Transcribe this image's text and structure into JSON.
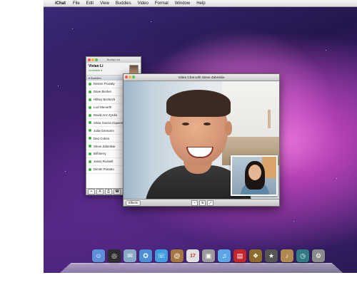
{
  "menubar": {
    "app": "iChat",
    "items": [
      "File",
      "Edit",
      "View",
      "Buddies",
      "Video",
      "Format",
      "Window",
      "Help"
    ]
  },
  "buddy_list": {
    "title": "Buddy List",
    "user_name": "Vivian Li",
    "user_status": "Available ▾",
    "group": "▾ Buddies",
    "buddies": [
      "Darren Prosaty",
      "Dave Becker",
      "Hillary Beckrich",
      "Luci Menerth",
      "David Anz Zyrdio",
      "Silvia Garcia Izquierdo",
      "Julia Gremarm",
      "Dan Cohen",
      "Steve Zabriskie",
      "Bill Berry",
      "Jason Russell",
      "Dimitri Prasato"
    ],
    "bottom_buttons": [
      "+",
      "A",
      "⎙",
      "☎"
    ]
  },
  "video_chat": {
    "title": "Video Chat with Steve Zabriskie",
    "effects_label": "Effects",
    "control_buttons": [
      "+",
      "⇅",
      "⤢"
    ]
  },
  "colors": {
    "close": "#f0574a",
    "minimize": "#f5b33a",
    "zoom": "#5cc443",
    "online": "#39b53f"
  },
  "dock": {
    "icons": [
      {
        "name": "finder-icon",
        "glyph": "☺",
        "color": "#5b90d8"
      },
      {
        "name": "dashboard-icon",
        "glyph": "◎",
        "color": "#2d2d2d"
      },
      {
        "name": "mail-icon",
        "glyph": "✉",
        "color": "#8aa9c8"
      },
      {
        "name": "safari-icon",
        "glyph": "✪",
        "color": "#4a8fd6"
      },
      {
        "name": "ichat-icon",
        "glyph": "☏",
        "color": "#3f9de0"
      },
      {
        "name": "address-book-icon",
        "glyph": "@",
        "color": "#a5773f"
      },
      {
        "name": "ical-icon",
        "glyph": "17",
        "color": "#e0e0e0"
      },
      {
        "name": "preview-icon",
        "glyph": "▣",
        "color": "#9a9a9a"
      },
      {
        "name": "itunes-icon",
        "glyph": "♫",
        "color": "#5aa6e6"
      },
      {
        "name": "photo-booth-icon",
        "glyph": "▤",
        "color": "#c4262b"
      },
      {
        "name": "iphoto-icon",
        "glyph": "❖",
        "color": "#8c6b2b"
      },
      {
        "name": "imovie-icon",
        "glyph": "★",
        "color": "#555555"
      },
      {
        "name": "garageband-icon",
        "glyph": "♪",
        "color": "#b08950"
      },
      {
        "name": "time-machine-icon",
        "glyph": "◷",
        "color": "#2f7a83"
      },
      {
        "name": "system-prefs-icon",
        "glyph": "⚙",
        "color": "#8a8a8a"
      }
    ]
  }
}
